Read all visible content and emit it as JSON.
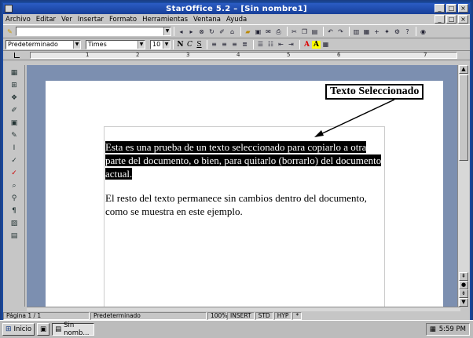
{
  "window": {
    "title": "StarOffice 5.2 – [Sin nombre1]",
    "controls": [
      "_",
      "□",
      "×"
    ],
    "doc_controls": [
      "_",
      "□",
      "×"
    ]
  },
  "menu": [
    "Archivo",
    "Editar",
    "Ver",
    "Insertar",
    "Formato",
    "Herramientas",
    "Ventana",
    "Ayuda"
  ],
  "toolbar": {
    "url_value": "",
    "style_value": "Predeterminado",
    "font_value": "Times",
    "size_value": "10",
    "bold_label": "N",
    "italic_label": "C",
    "underline_label": "S",
    "font_color_label": "A",
    "highlight_label": "A"
  },
  "ruler": {
    "labels": [
      "1",
      "2",
      "3",
      "4",
      "5",
      "6",
      "7"
    ]
  },
  "document": {
    "selected_text": " Esta es una prueba de un texto seleccionado para copiarlo a otra parte del documento, o bien, para quitarlo (borrarlo) del documento actual.",
    "body_text": " El resto del texto permanece sin cambios dentro del documento, como se muestra en este ejemplo.",
    "callout": "Texto Seleccionado"
  },
  "status": {
    "page": "Página 1 / 1",
    "style": "Predeterminado",
    "zoom": "100%",
    "insert": "INSERT",
    "std": "STD",
    "hyp": "HYP",
    "star": "*"
  },
  "taskbar": {
    "start": "Inicio",
    "task": "Sin nomb...",
    "clock": "5:59 PM"
  }
}
